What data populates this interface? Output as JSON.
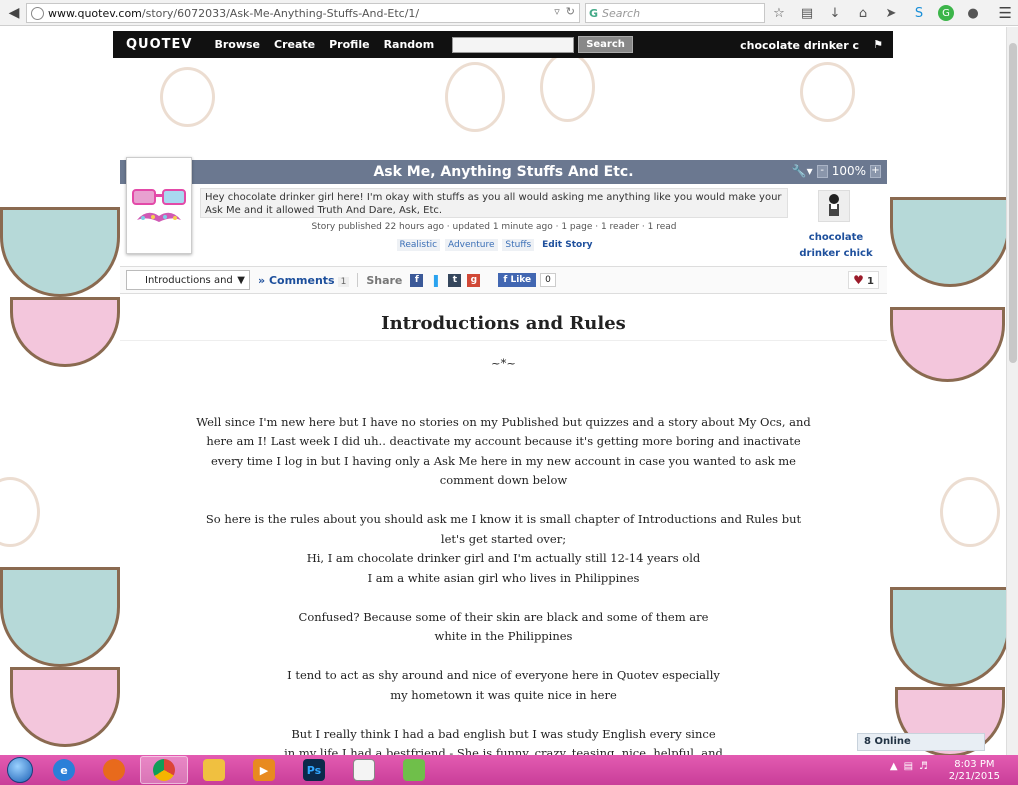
{
  "browser": {
    "url_domain": "www.quotev.com",
    "url_path": "/story/6072033/Ask-Me-Anything-Stuffs-And-Etc/1/",
    "search_placeholder": "Search"
  },
  "site": {
    "logo": "QUOTEV",
    "nav": [
      "Browse",
      "Create",
      "Profile",
      "Random"
    ],
    "search_button": "Search",
    "user": "chocolate drinker c"
  },
  "story": {
    "title": "Ask Me, Anything Stuffs And Etc.",
    "zoom": "100%",
    "description": "Hey chocolate drinker girl here! I'm okay with stuffs as you all would asking me anything like you would make your Ask Me and it allowed Truth And Dare, Ask, Etc.",
    "meta": "Story published 22 hours ago · updated 1 minute ago · 1 page · 1 reader · 1 read",
    "tags": [
      "Realistic",
      "Adventure",
      "Stuffs"
    ],
    "edit_label": "Edit Story",
    "author": "chocolate drinker chick"
  },
  "toolbar": {
    "chapter": "Introductions and",
    "comments_label": "Comments",
    "comments_count": "1",
    "share_label": "Share",
    "like_label": "Like",
    "like_count": "0",
    "favorites": "1"
  },
  "chapter": {
    "title": "Introductions and Rules",
    "divider": "~*~",
    "paragraphs": [
      "Well since I'm new here but I have no stories on my Published but quizzes and a story about My Ocs, and here am I! Last week I did uh.. deactivate my account because it's getting more boring and inactivate every time I log in but I having only a Ask Me here in my new account in case you wanted to ask me comment down below",
      "So here is the rules about you should ask me I know it is small chapter of Introductions and Rules but let's get started over;\nHi, I am chocolate drinker girl and I'm actually still 12-14 years old\nI am a white asian girl who lives in Philippines",
      "Confused? Because some of their skin are black and some of them are\nwhite in the Philippines",
      "I tend to act as shy around and nice of everyone here in Quotev especially\nmy hometown it was quite nice in here",
      "But I really think I had a bad english but I was study English every since\nin my life I had a bestfriend - She is funny, crazy, teasing, nice, helpful, and\nweird about me"
    ]
  },
  "online": "8 Online",
  "taskbar": {
    "time": "8:03 PM",
    "date": "2/21/2015"
  }
}
